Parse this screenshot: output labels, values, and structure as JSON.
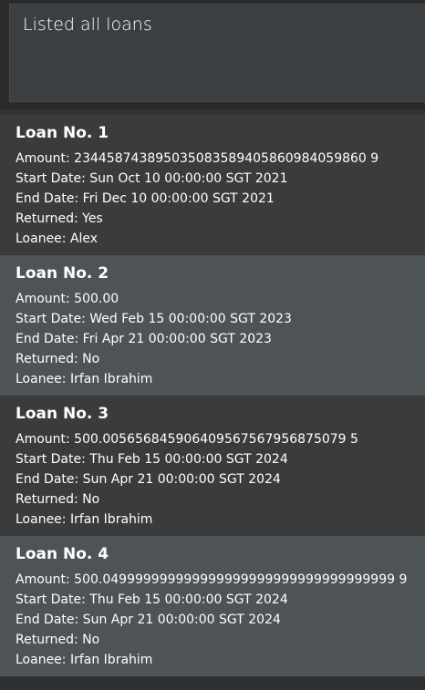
{
  "result": {
    "message": "Listed all loans"
  },
  "loans": [
    {
      "title": "Loan No. 1",
      "amount": "Amount: 234458743895035083589405860984059860 9",
      "start": "Start Date: Sun Oct 10 00:00:00 SGT 2021",
      "end": "End Date: Fri Dec 10 00:00:00 SGT 2021",
      "returned": "Returned: Yes",
      "loanee": "Loanee: Alex"
    },
    {
      "title": "Loan No. 2",
      "amount": "Amount: 500.00",
      "start": "Start Date: Wed Feb 15 00:00:00 SGT 2023",
      "end": "End Date: Fri Apr 21 00:00:00 SGT 2023",
      "returned": "Returned: No",
      "loanee": "Loanee: Irfan Ibrahim"
    },
    {
      "title": "Loan No. 3",
      "amount": "Amount: 500.005656845906409567567956875079 5",
      "start": "Start Date: Thu Feb 15 00:00:00 SGT 2024",
      "end": "End Date: Sun Apr 21 00:00:00 SGT 2024",
      "returned": "Returned: No",
      "loanee": "Loanee: Irfan Ibrahim"
    },
    {
      "title": "Loan No. 4",
      "amount": "Amount: 500.049999999999999999999999999999999999 9",
      "start": "Start Date: Thu Feb 15 00:00:00 SGT 2024",
      "end": "End Date: Sun Apr 21 00:00:00 SGT 2024",
      "returned": "Returned: No",
      "loanee": "Loanee: Irfan Ibrahim"
    }
  ]
}
